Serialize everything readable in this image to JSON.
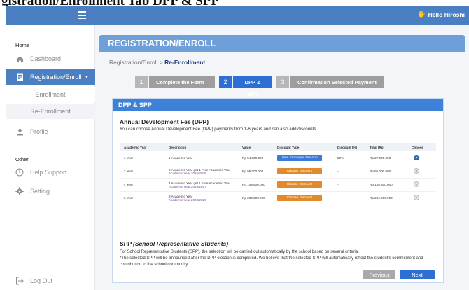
{
  "doc_title": "gistration/Enrollment Tab DPP & SPP",
  "topbar": {
    "greeting": "Hello Hiroshi"
  },
  "sidebar": {
    "home_label": "Home",
    "other_label": "Other",
    "items": {
      "dashboard": "Dashboard",
      "registration": "Registration/Enroll",
      "enrollment": "Enrollment",
      "re_enrollment": "Re-Enrollment",
      "profile": "Profile",
      "help_support": "Help Support",
      "setting": "Setting",
      "logout": "Log Out"
    }
  },
  "main": {
    "header": "REGISTRATION/ENROLL",
    "breadcrumb": {
      "parent": "Registration/Enroll",
      "separator": ">",
      "current": "Re-Enrollment"
    },
    "steps": [
      {
        "num": "1",
        "label": "Complete the Form"
      },
      {
        "num": "2",
        "label": "DPP & SPP"
      },
      {
        "num": "3",
        "label": "Confirmation Selected Payment"
      }
    ],
    "card_title": "DPP & SPP",
    "dpp": {
      "title": "Annual Development Fee (DPP)",
      "description": "You can choose Annual Development Fee (DPP) payments from 1-6 years and can also add discounts.",
      "columns": [
        "Academic Year",
        "Description",
        "Value",
        "Discount Type",
        "Discount (%)",
        "Total (Rp)",
        "Choose"
      ],
      "rows": [
        {
          "year": "1 Year",
          "desc_main": "1 Academic Year",
          "desc_sub": "",
          "value": "Rp 54.000.000",
          "discount_btn": "Upon Employee Discount",
          "discount_pct": "50%",
          "total": "Rp 27.000.000"
        },
        {
          "year": "2 Year",
          "desc_main": "2 Academic Year get 1 Free Academic Year",
          "desc_sub": "Academic Year 2025/2026",
          "value": "Rp 95.000.000",
          "discount_btn": "Choose Discount",
          "discount_pct": "-",
          "total": "Rp 95.000.000"
        },
        {
          "year": "4 Year",
          "desc_main": "4 Academic Year get 1 Free Academic Year",
          "desc_sub": "Academic Year 2026/2027",
          "value": "Rp 149.500.000",
          "discount_btn": "Choose Discount",
          "discount_pct": "-",
          "total": "Rp 149.500.000"
        },
        {
          "year": "6 Year",
          "desc_main": "6 Academic Year",
          "desc_sub": "Academic Year 2028/2029",
          "value": "Rp 204.000.000",
          "discount_btn": "Choose Discount",
          "discount_pct": "-",
          "total": "Rp 204.000.000"
        }
      ]
    },
    "spp": {
      "title": "SPP (School Representative Students)",
      "line1": "For School Representative Students (SPP), the selection will be carried out automatically by the school based on several criteria.",
      "line2": "*The selected SPP will be announced after the DPP election is completed. We believe that the selected SPP will automatically reflect the student's commitment and contribution to the school community."
    },
    "buttons": {
      "previous": "Previous",
      "next": "Next"
    }
  },
  "colors": {
    "accent": "#2d6fd3",
    "header": "#6f9fd8",
    "topbar": "#4a7fc1",
    "discount_orange": "#e08a2c"
  }
}
